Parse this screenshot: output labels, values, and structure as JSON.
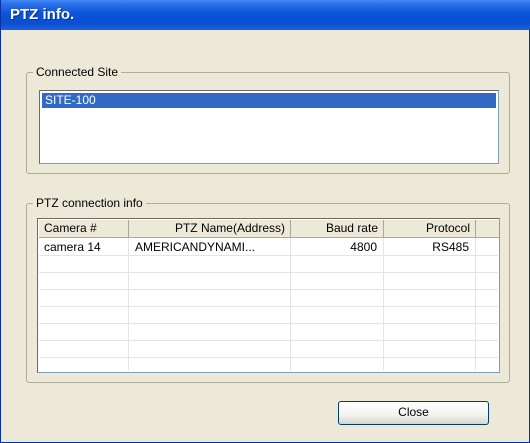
{
  "window": {
    "title": "PTZ info."
  },
  "connected_site": {
    "label": "Connected Site",
    "items": [
      "SITE-100"
    ],
    "selected_index": 0
  },
  "ptz_info": {
    "label": "PTZ connection info",
    "columns": [
      "Camera #",
      "PTZ Name(Address)",
      "Baud rate",
      "Protocol"
    ],
    "rows": [
      {
        "camera": "camera 14",
        "name": "AMERICANDYNAMI...",
        "baud": "4800",
        "protocol": "RS485"
      }
    ]
  },
  "buttons": {
    "close": "Close"
  }
}
